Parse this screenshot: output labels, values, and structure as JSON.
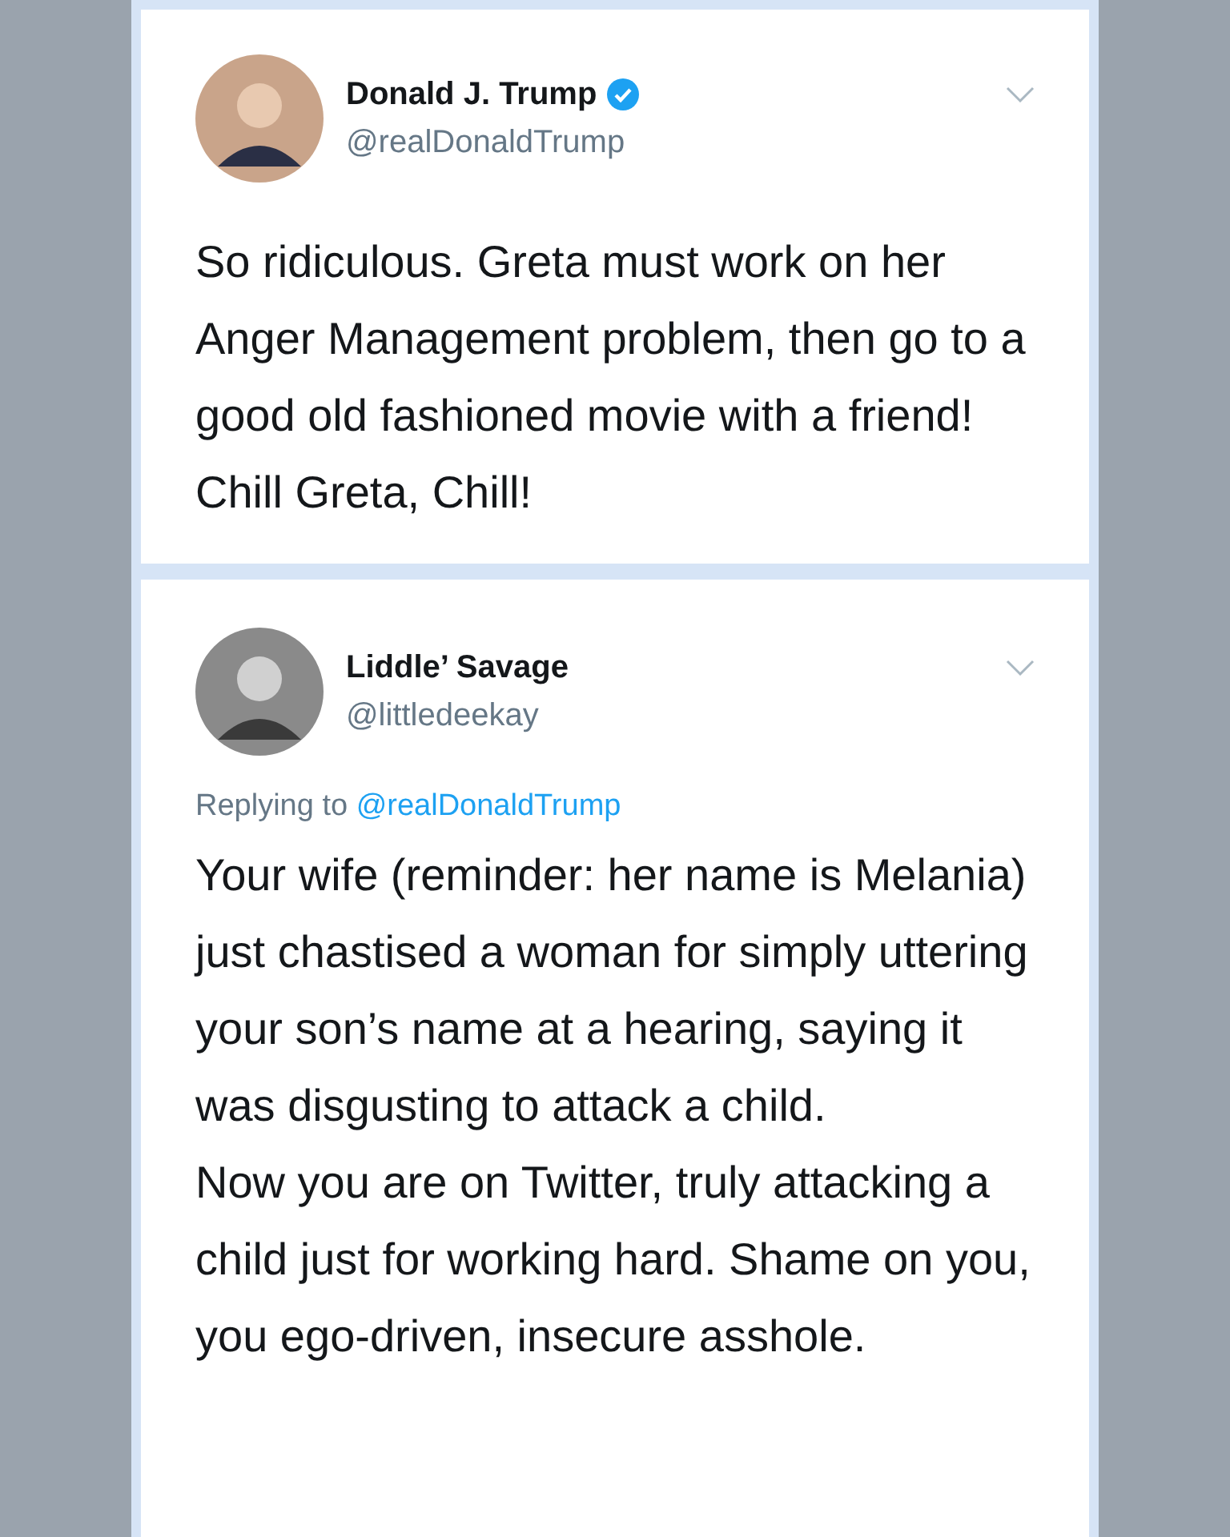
{
  "tweets": [
    {
      "name": "Donald J. Trump",
      "verified": true,
      "handle": "@realDonaldTrump",
      "paragraphs": [
        "So ridiculous. Greta must work on her Anger Management problem, then go to a good old fashioned movie with a friend! Chill Greta, Chill!"
      ]
    },
    {
      "name": "Liddle’ Savage",
      "verified": false,
      "handle": "@littledeekay",
      "replying_label": "Replying to",
      "replying_to": "@realDonaldTrump",
      "paragraphs": [
        "Your wife (reminder: her name is Melania) just chastised a woman for simply uttering your son’s name at a hearing, saying it was disgusting to attack a child.",
        "Now you are on Twitter, truly attacking a child just for working hard. Shame on you, you ego-driven, insecure asshole."
      ]
    }
  ]
}
